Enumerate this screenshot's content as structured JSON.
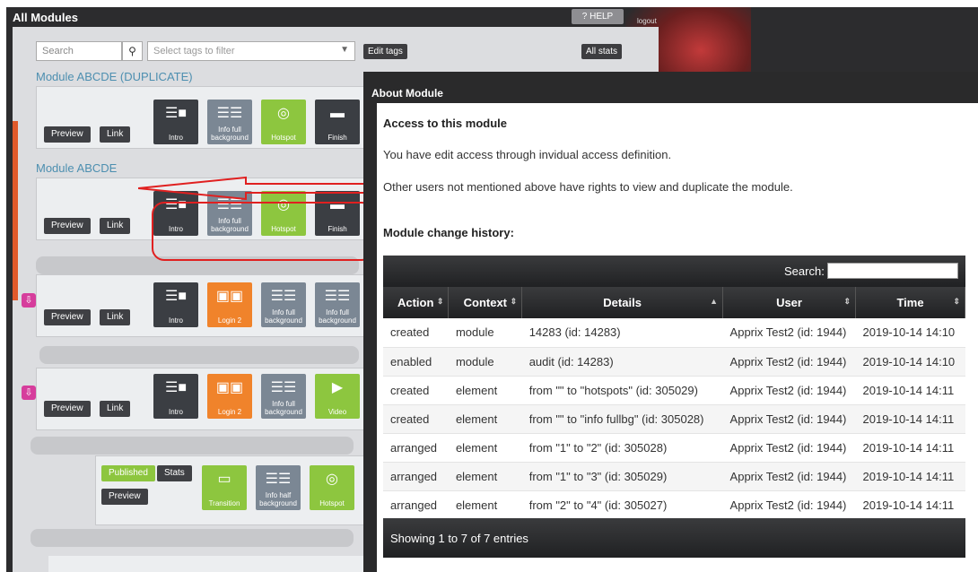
{
  "app": {
    "title": "All Modules",
    "help_label": "? HELP",
    "logout_label": "logout"
  },
  "toolbar": {
    "search_placeholder": "Search",
    "tag_placeholder": "Select tags to filter",
    "edit_tags_label": "Edit tags",
    "all_stats_label": "All stats"
  },
  "modules": [
    {
      "title": "Module ABCDE (DUPLICATE)",
      "preview_label": "Preview",
      "link_label": "Link",
      "tiles": [
        "Intro",
        "Info full background",
        "Hotspot",
        "Finish"
      ]
    },
    {
      "title": "Module ABCDE",
      "preview_label": "Preview",
      "link_label": "Link",
      "tiles": [
        "Intro",
        "Info full background",
        "Hotspot",
        "Finish"
      ]
    },
    {
      "preview_label": "Preview",
      "link_label": "Link",
      "tiles": [
        "Intro",
        "Login 2",
        "Info full background",
        "Info full background"
      ]
    },
    {
      "preview_label": "Preview",
      "link_label": "Link",
      "tiles": [
        "Intro",
        "Login 2",
        "Info full background",
        "Video"
      ]
    },
    {
      "published_label": "Published",
      "stats_label": "Stats",
      "preview_label": "Preview",
      "tiles": [
        "Transition",
        "Info half background",
        "Hotspot"
      ]
    }
  ],
  "modal": {
    "title": "About Module",
    "access_heading": "Access to this module",
    "access_text": "You have edit access through invidual access definition.",
    "others_text": "Other users not mentioned above have rights to view and duplicate the module.",
    "history_heading": "Module change history:",
    "search_label": "Search:",
    "columns": [
      "Action",
      "Context",
      "Details",
      "User",
      "Time"
    ],
    "rows": [
      [
        "created",
        "module",
        "14283 (id: 14283)",
        "Apprix Test2 (id: 1944)",
        "2019-10-14 14:10"
      ],
      [
        "enabled",
        "module",
        "audit (id: 14283)",
        "Apprix Test2 (id: 1944)",
        "2019-10-14 14:10"
      ],
      [
        "created",
        "element",
        "from \"\" to \"hotspots\" (id: 305029)",
        "Apprix Test2 (id: 1944)",
        "2019-10-14 14:11"
      ],
      [
        "created",
        "element",
        "from \"\" to \"info fullbg\" (id: 305028)",
        "Apprix Test2 (id: 1944)",
        "2019-10-14 14:11"
      ],
      [
        "arranged",
        "element",
        "from \"1\" to \"2\" (id: 305028)",
        "Apprix Test2 (id: 1944)",
        "2019-10-14 14:11"
      ],
      [
        "arranged",
        "element",
        "from \"1\" to \"3\" (id: 305029)",
        "Apprix Test2 (id: 1944)",
        "2019-10-14 14:11"
      ],
      [
        "arranged",
        "element",
        "from \"2\" to \"4\" (id: 305027)",
        "Apprix Test2 (id: 1944)",
        "2019-10-14 14:11"
      ]
    ],
    "footer_text": "Showing 1 to 7 of 7 entries"
  },
  "colors": {
    "accent_title": "#4d8fb0",
    "tile_dark": "#3b3e43",
    "tile_gray": "#7b8794",
    "tile_green": "#8dc63f",
    "tile_orange": "#f0832b",
    "annotation_red": "#e02020"
  },
  "icons": [
    "search-icon",
    "chevron-down-icon",
    "download-icon",
    "sort-icon",
    "sort-asc-icon"
  ]
}
